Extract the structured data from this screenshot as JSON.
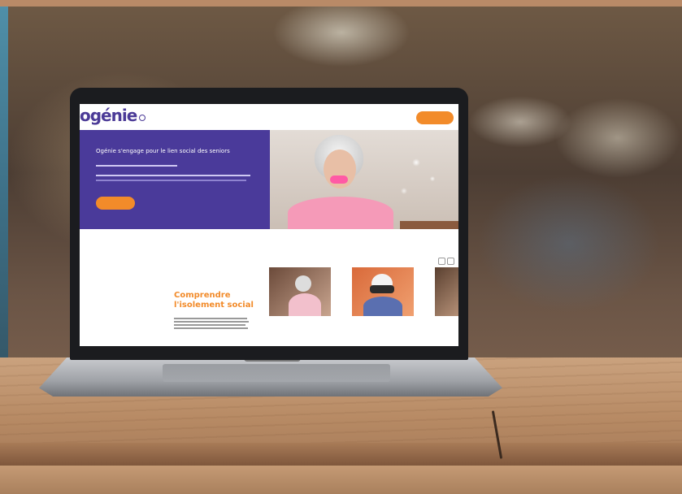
{
  "scene": {
    "description_colors": {
      "brand_purple": "#4a3a9a",
      "brand_orange": "#f28b2a"
    }
  },
  "screen": {
    "logo": "ogénie",
    "logo_sub": "",
    "nav_link": "",
    "nav_right": "",
    "nav_button": "",
    "hero_title": "Ogénie s'engage pour le lien social des seniors",
    "hero_lines": [],
    "hero_button": "",
    "hero_link": "",
    "section_title": "Comprendre l'isolement social",
    "cards": [
      {
        "caption": ""
      },
      {
        "caption": ""
      },
      {
        "caption": ""
      }
    ]
  }
}
